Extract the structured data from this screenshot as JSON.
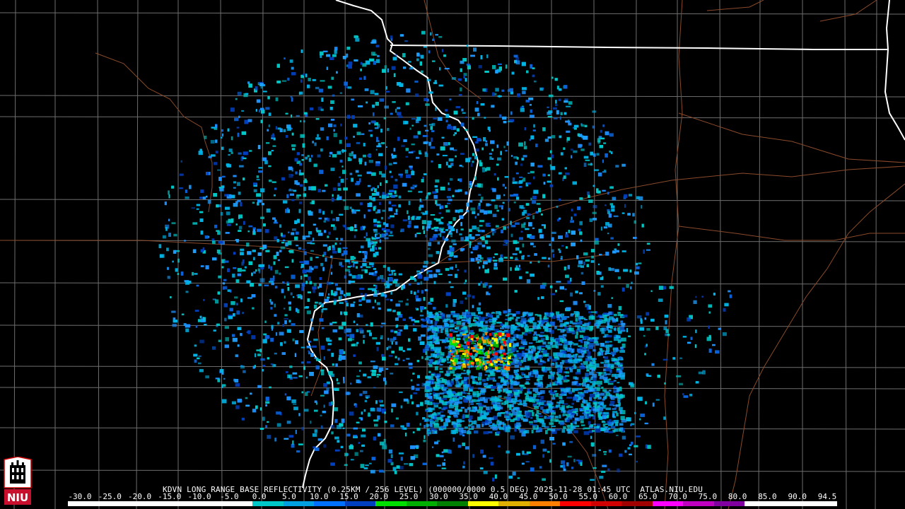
{
  "radar": {
    "caption": "KDVN LONG RANGE BASE REFLECTIVITY (0.25KM / 256 LEVEL) (000000/0000 0.5 DEG) 2025-11-28 01:45 UTC  ATLAS.NIU.EDU",
    "product": "Base Reflectivity",
    "station": "KDVN"
  },
  "legend": {
    "scale_labels": [
      "-30.0",
      "-25.0",
      "-20.0",
      "-15.0",
      "-10.0",
      "-5.0",
      "0.0",
      "5.0",
      "10.0",
      "15.0",
      "20.0",
      "25.0",
      "30.0",
      "35.0",
      "40.0",
      "45.0",
      "50.0",
      "55.0",
      "60.0",
      "65.0",
      "70.0",
      "75.0",
      "80.0",
      "85.0",
      "90.0",
      "94.5"
    ],
    "colors": [
      "#ffffff",
      "#ffffff",
      "#ffffff",
      "#ffffff",
      "#ffffff",
      "#ffffff",
      "#00c8c8",
      "#00a0e0",
      "#0070ff",
      "#0040c0",
      "#00e000",
      "#00b000",
      "#008000",
      "#ffff00",
      "#e0b000",
      "#ff8000",
      "#ff0000",
      "#d00000",
      "#a00000",
      "#ff00ff",
      "#c000c0",
      "#8000a0",
      "#ffffff",
      "#ffffff",
      "#ffffff"
    ]
  },
  "logo": {
    "text": "NIU"
  },
  "colors": {
    "background": "#000000",
    "county_lines": "#6e6e6e",
    "state_lines": "#ffffff",
    "roads": "#8a4a2a"
  }
}
